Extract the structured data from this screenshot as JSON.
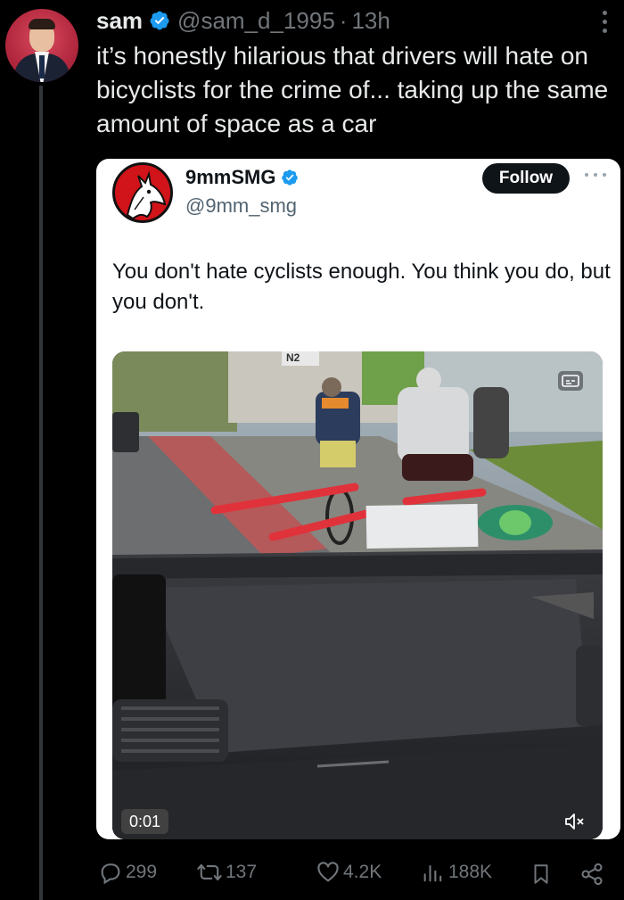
{
  "post": {
    "author": {
      "name": "sam",
      "handle": "@sam_d_1995",
      "separator": "·",
      "time": "13h"
    },
    "text": "it’s honestly hilarious that drivers will hate on bicyclists for the crime of... taking up the same amount of space as a car"
  },
  "quoted": {
    "author": {
      "name": "9mmSMG",
      "handle": "@9mm_smg"
    },
    "follow_label": "Follow",
    "text": "You don't hate cyclists enough. You think you do, but you don't.",
    "video": {
      "timestamp": "0:01",
      "plate_text": "N2"
    }
  },
  "actions": {
    "replies": "299",
    "reposts": "137",
    "likes": "4.2K",
    "views": "188K"
  },
  "colors": {
    "background": "#000000",
    "text_primary": "#e7e9ea",
    "text_secondary": "#71767b",
    "verified": "#1d9bf0",
    "card_bg": "#ffffff"
  },
  "icons": [
    "verified-badge-icon",
    "more-vertical-icon",
    "more-horizontal-icon",
    "reply-icon",
    "repost-icon",
    "like-icon",
    "views-icon",
    "bookmark-icon",
    "share-icon",
    "mute-icon",
    "captions-icon"
  ]
}
